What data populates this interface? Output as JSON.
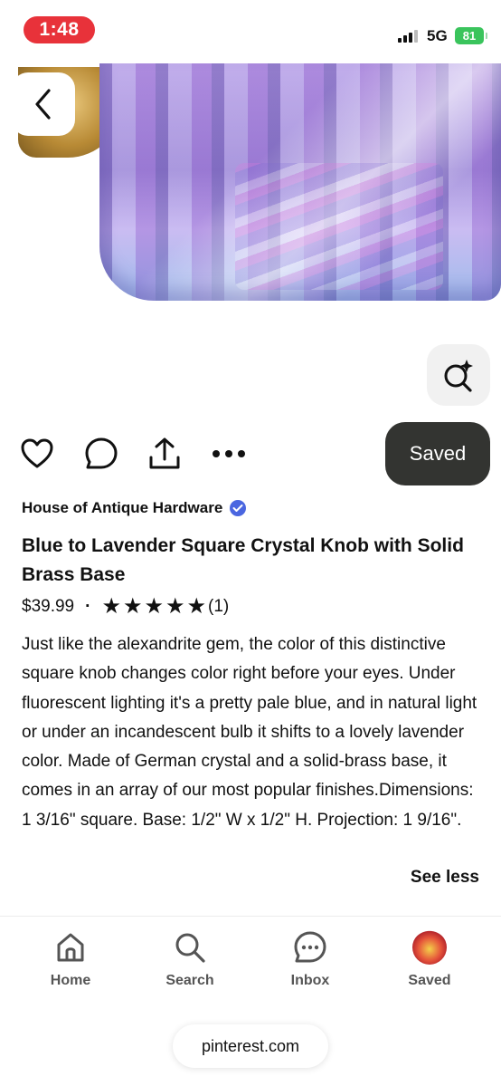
{
  "status": {
    "time": "1:48",
    "network": "5G",
    "battery": "81"
  },
  "hero": {
    "image": "crystal-knob-photo",
    "back_icon": "chevron-left-icon",
    "lens_icon": "visual-search-icon"
  },
  "actions": {
    "icons": [
      "heart-icon",
      "comment-icon",
      "share-icon",
      "more-icon"
    ],
    "saved_label": "Saved"
  },
  "pin": {
    "seller": "House of Antique Hardware",
    "title": "Blue to Lavender Square Crystal Knob with Solid Brass Base",
    "price": "$39.99",
    "separator": "·",
    "rating_stars": 5,
    "rating_count": "(1)",
    "description": "Just like the alexandrite gem, the color of this distinctive square knob changes color right before your eyes. Under fluorescent lighting it's a pretty pale blue, and in natural light or under an incandescent bulb it shifts to a lovely lavender color. Made of German crystal and a solid-brass base, it comes in an array of our most popular finishes.Dimensions: 1 3/16\" square. Base: 1/2\" W x 1/2\" H. Projection: 1 9/16\".",
    "see_less": "See less"
  },
  "nav": {
    "items": [
      {
        "label": "Home",
        "icon": "home-icon"
      },
      {
        "label": "Search",
        "icon": "search-icon"
      },
      {
        "label": "Inbox",
        "icon": "inbox-icon"
      },
      {
        "label": "Saved",
        "icon": "profile-avatar"
      }
    ]
  },
  "browser": {
    "url": "pinterest.com"
  },
  "colors": {
    "time_pill": "#e8323a",
    "battery": "#3ac45c",
    "saved_button": "#333431",
    "verified_badge": "#4a66e0"
  }
}
